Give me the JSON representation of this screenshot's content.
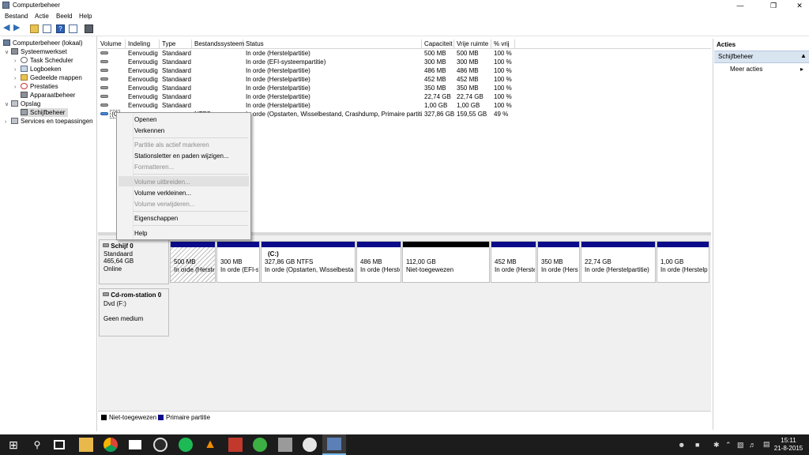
{
  "window": {
    "title": "Computerbeheer"
  },
  "menu": [
    "Bestand",
    "Actie",
    "Beeld",
    "Help"
  ],
  "tree": {
    "root": "Computerbeheer (lokaal)",
    "systeem": "Systeemwerkset",
    "task": "Task Scheduler",
    "log": "Logboeken",
    "shared": "Gedeelde mappen",
    "perf": "Prestaties",
    "devmgr": "Apparaatbeheer",
    "opslag": "Opslag",
    "disk": "Schijfbeheer",
    "services": "Services en toepassingen"
  },
  "table": {
    "headers": [
      "Volume",
      "Indeling",
      "Type",
      "Bestandssysteem",
      "Status",
      "Capaciteit",
      "Vrije ruimte",
      "% vrij"
    ],
    "rows": [
      [
        "",
        "Eenvoudig",
        "Standaard",
        "",
        "In orde (Herstelpartitie)",
        "500 MB",
        "500 MB",
        "100 %"
      ],
      [
        "",
        "Eenvoudig",
        "Standaard",
        "",
        "In orde (EFI-systeempartitie)",
        "300 MB",
        "300 MB",
        "100 %"
      ],
      [
        "",
        "Eenvoudig",
        "Standaard",
        "",
        "In orde (Herstelpartitie)",
        "486 MB",
        "486 MB",
        "100 %"
      ],
      [
        "",
        "Eenvoudig",
        "Standaard",
        "",
        "In orde (Herstelpartitie)",
        "452 MB",
        "452 MB",
        "100 %"
      ],
      [
        "",
        "Eenvoudig",
        "Standaard",
        "",
        "In orde (Herstelpartitie)",
        "350 MB",
        "350 MB",
        "100 %"
      ],
      [
        "",
        "Eenvoudig",
        "Standaard",
        "",
        "In orde (Herstelpartitie)",
        "22,74 GB",
        "22,74 GB",
        "100 %"
      ],
      [
        "",
        "Eenvoudig",
        "Standaard",
        "",
        "In orde (Herstelpartitie)",
        "1,00 GB",
        "1,00 GB",
        "100 %"
      ],
      [
        "(C",
        "",
        "",
        "NTFS",
        "In orde (Opstarten, Wisselbestand, Crashdump, Primaire partitie)",
        "327,86 GB",
        "159,55 GB",
        "49 %"
      ]
    ]
  },
  "context_menu": {
    "open": "Openen",
    "explore": "Verkennen",
    "mark_active": "Partitie als actief markeren",
    "change_letter": "Stationsletter en paden wijzigen...",
    "format": "Formatteren...",
    "extend": "Volume uitbreiden...",
    "shrink": "Volume verkleinen...",
    "delete": "Volume verwijderen...",
    "properties": "Eigenschappen",
    "help": "Help"
  },
  "disk0": {
    "name": "Schijf 0",
    "type": "Standaard",
    "size": "465,64 GB",
    "state": "Online",
    "partitions": [
      {
        "size": "500 MB",
        "status": "In orde (Herste"
      },
      {
        "size": "300 MB",
        "status": "In orde (EFI-s"
      },
      {
        "label": "(C:)",
        "size": "327,86 GB NTFS",
        "status": "In orde (Opstarten, Wisselbestand"
      },
      {
        "size": "486 MB",
        "status": "In orde (Herste"
      },
      {
        "size": "112,00 GB",
        "status": "Niet-toegewezen"
      },
      {
        "size": "452 MB",
        "status": "In orde (Herste"
      },
      {
        "size": "350 MB",
        "status": "In orde (Herste"
      },
      {
        "size": "22,74 GB",
        "status": "In orde (Herstelpartitie)"
      },
      {
        "size": "1,00 GB",
        "status": "In orde (Herstelpa"
      }
    ]
  },
  "cdrom": {
    "name": "Cd-rom-station 0",
    "type": "Dvd (F:)",
    "state": "Geen medium"
  },
  "legend": {
    "unallocated": "Niet-toegewezen",
    "primary": "Primaire partitie"
  },
  "actions": {
    "title": "Acties",
    "section": "Schijfbeheer",
    "more": "Meer acties"
  },
  "taskbar": {
    "time": "15:11",
    "date": "21-8-2015"
  },
  "colors": {
    "primary_bar": "#0a0a8a",
    "unallocated_bar": "#000000",
    "actions_section_bg": "#d9e4f1"
  }
}
